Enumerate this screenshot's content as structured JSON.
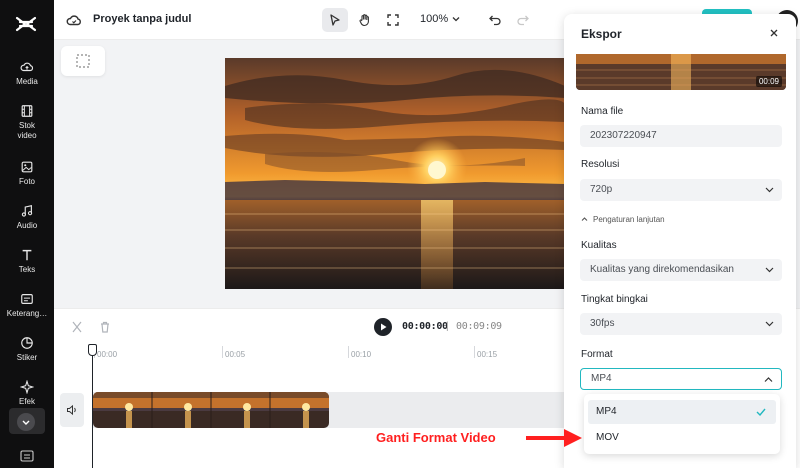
{
  "sidebar": {
    "items": [
      {
        "label": "Media",
        "icon": "cloud-upload-icon"
      },
      {
        "label": "Stok video",
        "icon": "film-icon"
      },
      {
        "label": "Foto",
        "icon": "image-icon"
      },
      {
        "label": "Audio",
        "icon": "music-note-icon"
      },
      {
        "label": "Teks",
        "icon": "text-icon"
      },
      {
        "label": "Keterang…",
        "icon": "captions-icon"
      },
      {
        "label": "Stiker",
        "icon": "sticker-icon"
      },
      {
        "label": "Efek",
        "icon": "effects-icon"
      }
    ]
  },
  "header": {
    "project_title": "Proyek tanpa judul",
    "zoom": "100%"
  },
  "player": {
    "current_time": "00:00:00",
    "separator": "|",
    "total_time": "00:09:09"
  },
  "timeline": {
    "ticks": [
      "00:00",
      "00:05",
      "00:10",
      "00:15"
    ]
  },
  "export_panel": {
    "title": "Ekspor",
    "thumbnail_duration": "00:09",
    "filename_label": "Nama file",
    "filename_value": "202307220947",
    "resolution_label": "Resolusi",
    "resolution_value": "720p",
    "advanced_label": "Pengaturan lanjutan",
    "quality_label": "Kualitas",
    "quality_value": "Kualitas yang direkomendasikan",
    "framerate_label": "Tingkat bingkai",
    "framerate_value": "30fps",
    "format_label": "Format",
    "format_value": "MP4",
    "format_options": [
      "MP4",
      "MOV"
    ],
    "accent_color": "#22b8c0"
  },
  "annotation": {
    "text": "Ganti Format Video",
    "color": "#ff1f1f"
  }
}
